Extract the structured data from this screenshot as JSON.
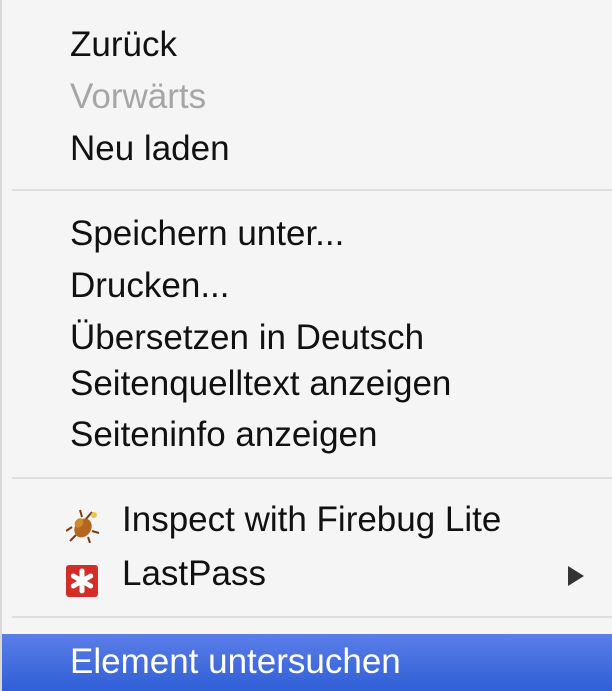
{
  "menu": {
    "group1": [
      {
        "label": "Zurück",
        "enabled": true
      },
      {
        "label": "Vorwärts",
        "enabled": false
      },
      {
        "label": "Neu laden",
        "enabled": true
      }
    ],
    "group2": [
      {
        "label": "Speichern unter..."
      },
      {
        "label": "Drucken..."
      },
      {
        "label": "Übersetzen in Deutsch"
      },
      {
        "label": "Seitenquelltext anzeigen"
      },
      {
        "label": "Seiteninfo anzeigen"
      }
    ],
    "group3": [
      {
        "label": "Inspect with Firebug Lite",
        "icon": "firebug-icon"
      },
      {
        "label": "LastPass",
        "icon": "lastpass-icon",
        "submenu": true
      }
    ],
    "group4": [
      {
        "label": "Element untersuchen",
        "selected": true
      }
    ]
  },
  "colors": {
    "selection": "#3b6ae0",
    "disabled_text": "#a6a6a6"
  }
}
